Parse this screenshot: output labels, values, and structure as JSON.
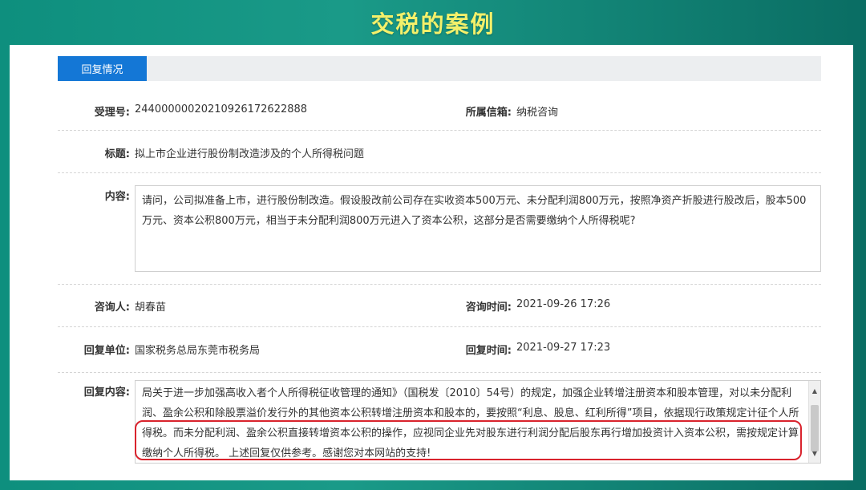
{
  "banner": {
    "title": "交税的案例"
  },
  "tabs": [
    {
      "label": "回复情况"
    }
  ],
  "fields": {
    "accept_no_label": "受理号:",
    "accept_no_value": "2440000002021092617262288​8",
    "mailbox_label": "所属信箱:",
    "mailbox_value": "纳税咨询",
    "title_label": "标题:",
    "title_value": "拟上市企业进行股份制改造涉及的个人所得税问题",
    "content_label": "内容:",
    "content_value": "请问，公司拟准备上市，进行股份制改造。假设股改前公司存在实收资本500万元、未分配利润800万元，按照净资产折股进行股改后，股本500万元、资本公积800万元，相当于未分配利润800万元进入了资本公积，这部分是否需要缴纳个人所得税呢?",
    "asker_label": "咨询人:",
    "asker_value": "胡春苗",
    "ask_time_label": "咨询时间:",
    "ask_time_value": "2021-09-26 17:26",
    "reply_unit_label": "回复单位:",
    "reply_unit_value": "国家税务总局东莞市税务局",
    "reply_time_label": "回复时间:",
    "reply_time_value": "2021-09-27 17:23",
    "reply_content_label": "回复内容:",
    "reply_content_value": "局关于进一步加强高收入者个人所得税征收管理的通知》（国税发〔2010〕54号）的规定，加强企业转增注册资本和股本管理，对以未分配利润、盈余公积和除股票溢价发行外的其他资本公积转增注册资本和股本的，要按照“利息、股息、红利所得”项目，依据现行政策规定计征个人所得税。而未分配利润、盈余公积直接转增资本公积的操作，应视同企业先对股东进行利润分配后股东再行增加投资计入资本公积，需按规定计算缴纳个人所得税。 上述回复仅供参考。感谢您对本网站的支持!"
  },
  "colors": {
    "banner_text": "#f3f06a",
    "tab_active": "#1477d6",
    "highlight": "#d9232d"
  }
}
